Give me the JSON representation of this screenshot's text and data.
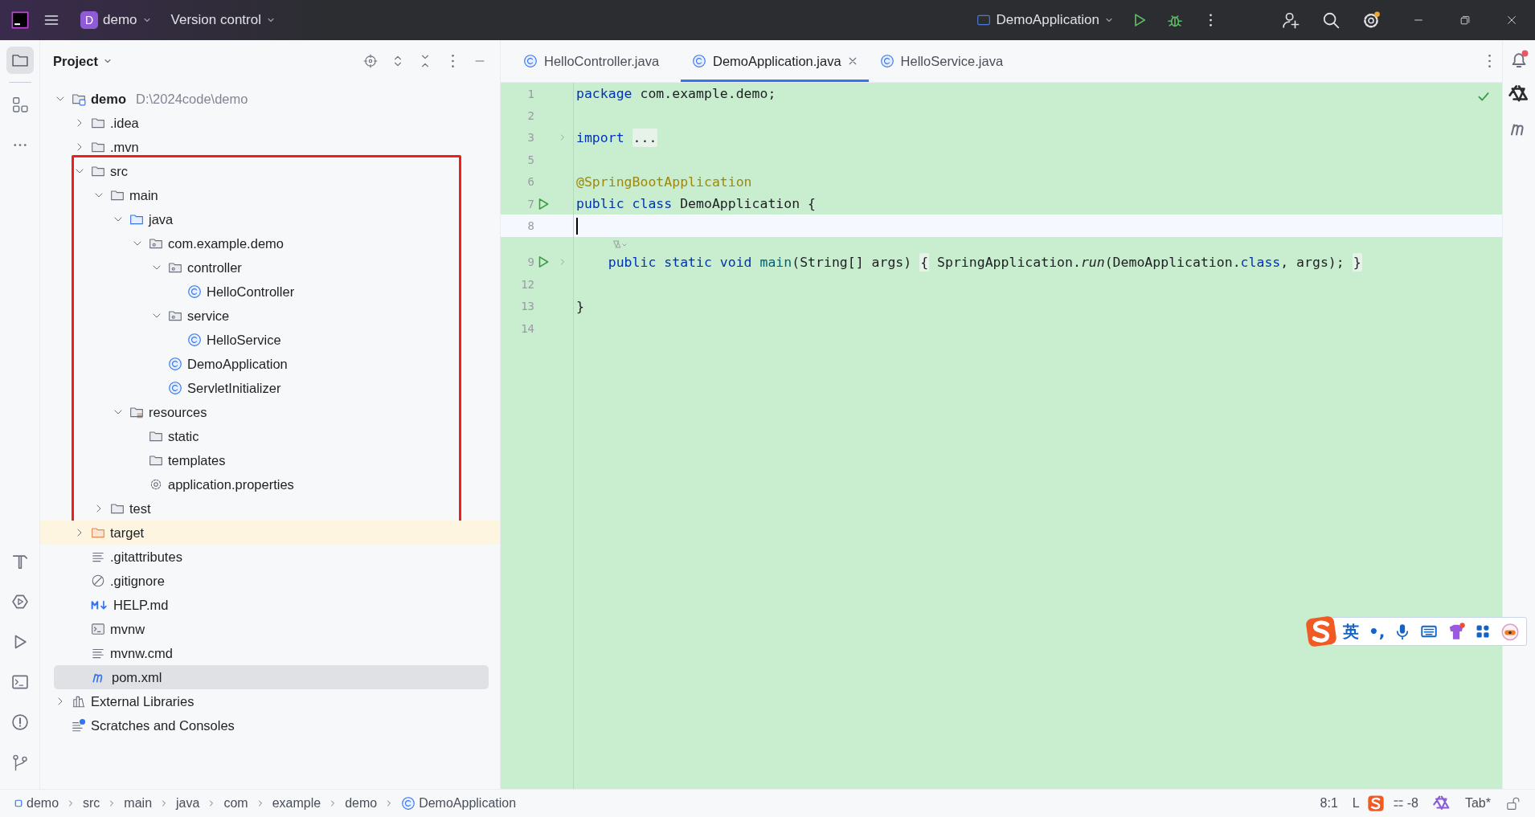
{
  "title_bar": {
    "project": {
      "initial": "D",
      "name": "demo"
    },
    "vcs": "Version control",
    "run_config": "DemoApplication"
  },
  "project_panel": {
    "title": "Project",
    "tree": [
      {
        "label": "demo",
        "kind": "module",
        "path": "D:\\2024code\\demo",
        "expanded": true,
        "selected": false,
        "children": [
          {
            "label": ".idea",
            "kind": "folder",
            "expanded": false,
            "selected": false,
            "highlighted": false
          },
          {
            "label": ".mvn",
            "kind": "folder",
            "expanded": false,
            "selected": false,
            "highlighted": false
          },
          {
            "label": "src",
            "kind": "folder",
            "expanded": true,
            "selected": false,
            "highlighted": true,
            "children": [
              {
                "label": "main",
                "kind": "folder",
                "expanded": true,
                "selected": false,
                "children": [
                  {
                    "label": "java",
                    "kind": "source-folder",
                    "expanded": true,
                    "selected": false,
                    "children": [
                      {
                        "label": "com.example.demo",
                        "kind": "package",
                        "expanded": true,
                        "selected": false,
                        "children": [
                          {
                            "label": "controller",
                            "kind": "package",
                            "expanded": true,
                            "selected": false,
                            "children": [
                              {
                                "label": "HelloController",
                                "kind": "class",
                                "selected": false
                              }
                            ]
                          },
                          {
                            "label": "service",
                            "kind": "package",
                            "expanded": true,
                            "selected": false,
                            "children": [
                              {
                                "label": "HelloService",
                                "kind": "class",
                                "selected": false
                              }
                            ]
                          },
                          {
                            "label": "DemoApplication",
                            "kind": "class",
                            "selected": false
                          },
                          {
                            "label": "ServletInitializer",
                            "kind": "class",
                            "selected": false
                          }
                        ]
                      }
                    ]
                  },
                  {
                    "label": "resources",
                    "kind": "resources-folder",
                    "expanded": true,
                    "selected": false,
                    "children": [
                      {
                        "label": "static",
                        "kind": "folder",
                        "selected": false
                      },
                      {
                        "label": "templates",
                        "kind": "folder",
                        "selected": false
                      },
                      {
                        "label": "application.properties",
                        "kind": "properties",
                        "selected": false
                      }
                    ]
                  }
                ]
              },
              {
                "label": "test",
                "kind": "folder",
                "expanded": false,
                "selected": false
              }
            ]
          },
          {
            "label": "target",
            "kind": "excluded-folder",
            "expanded": false,
            "selected": false,
            "highlighted": false
          },
          {
            "label": ".gitattributes",
            "kind": "text",
            "selected": false,
            "highlighted": false
          },
          {
            "label": ".gitignore",
            "kind": "ignore",
            "selected": false,
            "highlighted": false
          },
          {
            "label": "HELP.md",
            "kind": "markdown",
            "selected": false,
            "highlighted": false
          },
          {
            "label": "mvnw",
            "kind": "script",
            "selected": false,
            "highlighted": false
          },
          {
            "label": "mvnw.cmd",
            "kind": "text",
            "selected": false,
            "highlighted": false
          },
          {
            "label": "pom.xml",
            "kind": "maven",
            "selected": true,
            "highlighted": false
          }
        ]
      },
      {
        "label": "External Libraries",
        "kind": "libraries",
        "expanded": false,
        "selected": false
      },
      {
        "label": "Scratches and Consoles",
        "kind": "scratches",
        "selected": false
      }
    ]
  },
  "editor": {
    "tabs": [
      {
        "label": "HelloController.java",
        "selected": false
      },
      {
        "label": "DemoApplication.java",
        "selected": true
      },
      {
        "label": "HelloService.java",
        "selected": false
      }
    ],
    "lines": [
      {
        "number": "1",
        "current": false,
        "run": false,
        "foldable": false,
        "inlay_hint": false,
        "tokens": [
          {
            "kind": "keyword",
            "text": "package"
          },
          {
            "kind": "plain",
            "text": " com.example.demo;"
          }
        ]
      },
      {
        "number": "2",
        "current": false,
        "run": false,
        "foldable": false,
        "inlay_hint": false
      },
      {
        "number": "3",
        "current": false,
        "run": false,
        "foldable": true,
        "inlay_hint": false,
        "tokens": [
          {
            "kind": "keyword",
            "text": "import "
          },
          {
            "kind": "folded",
            "text": "..."
          }
        ]
      },
      {
        "number": "5",
        "current": false,
        "run": false,
        "foldable": false,
        "inlay_hint": false
      },
      {
        "number": "6",
        "current": false,
        "run": false,
        "foldable": false,
        "inlay_hint": false,
        "tokens": [
          {
            "kind": "annotation",
            "text": "@SpringBootApplication"
          }
        ]
      },
      {
        "number": "7",
        "current": false,
        "run": true,
        "foldable": false,
        "inlay_hint": false,
        "tokens": [
          {
            "kind": "keyword",
            "text": "public class"
          },
          {
            "kind": "plain",
            "text": " DemoApplication {"
          }
        ]
      },
      {
        "number": "8",
        "current": true,
        "run": false,
        "foldable": false,
        "inlay_hint": false
      },
      {
        "number": "9",
        "current": false,
        "run": true,
        "foldable": true,
        "inlay_hint": true,
        "tokens": [
          {
            "kind": "keyword",
            "text": "    public static void "
          },
          {
            "kind": "method",
            "text": "main"
          },
          {
            "kind": "plain",
            "text": "(String[] args) "
          },
          {
            "kind": "folded",
            "text": "{"
          },
          {
            "kind": "plain",
            "text": " SpringApplication."
          },
          {
            "kind": "static-call",
            "text": "run"
          },
          {
            "kind": "plain",
            "text": "(DemoApplication."
          },
          {
            "kind": "keyword",
            "text": "class"
          },
          {
            "kind": "plain",
            "text": ", args); "
          },
          {
            "kind": "folded",
            "text": "}"
          }
        ]
      },
      {
        "number": "12",
        "current": false,
        "run": false,
        "foldable": false,
        "inlay_hint": false
      },
      {
        "number": "13",
        "current": false,
        "run": false,
        "foldable": false,
        "inlay_hint": false,
        "tokens": [
          {
            "kind": "plain",
            "text": "}"
          }
        ]
      },
      {
        "number": "14",
        "current": false,
        "run": false,
        "foldable": false,
        "inlay_hint": false
      }
    ]
  },
  "status_bar": {
    "breadcrumbs": [
      {
        "label": "demo",
        "kind": "module"
      },
      {
        "label": "src",
        "kind": "plain"
      },
      {
        "label": "main",
        "kind": "plain"
      },
      {
        "label": "java",
        "kind": "plain"
      },
      {
        "label": "com",
        "kind": "plain"
      },
      {
        "label": "example",
        "kind": "plain"
      },
      {
        "label": "demo",
        "kind": "plain"
      },
      {
        "label": "DemoApplication",
        "kind": "class"
      }
    ],
    "position": "8:1",
    "line_separator": "L",
    "indent_delta": "-8",
    "indent": "Tab*",
    "read_only": false
  },
  "ime_toolbar": {
    "language": "英",
    "punctuation": "•,"
  }
}
